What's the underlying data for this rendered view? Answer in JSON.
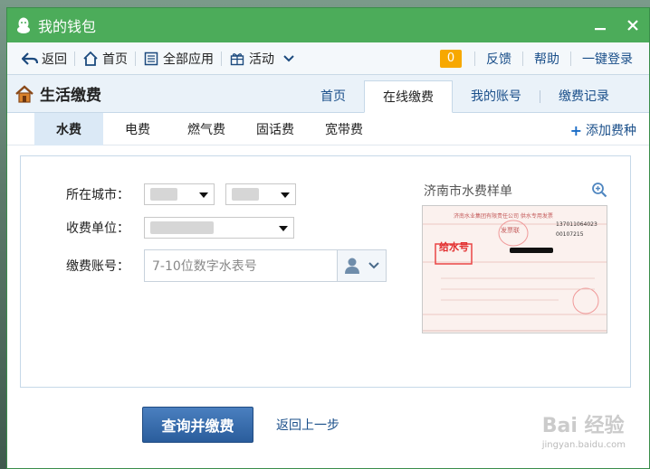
{
  "window": {
    "title": "我的钱包"
  },
  "toolbar": {
    "back": "返回",
    "home": "首页",
    "all_apps": "全部应用",
    "activity": "活动",
    "badge_count": "0",
    "feedback": "反馈",
    "help": "帮助",
    "login": "一键登录"
  },
  "section": {
    "title": "生活缴费",
    "tabs": [
      "首页",
      "在线缴费",
      "我的账号",
      "缴费记录"
    ],
    "active_tab": "在线缴费"
  },
  "subtabs": {
    "items": [
      "水费",
      "电费",
      "燃气费",
      "固话费",
      "宽带费"
    ],
    "active": "水费",
    "add_label": "添加费种"
  },
  "form": {
    "city_label": "所在城市：",
    "unit_label": "收费单位：",
    "account_label": "缴费账号：",
    "account_placeholder": "7-10位数字水表号"
  },
  "sample": {
    "title": "济南市水费样单",
    "bill_header": "济南水业集团有限责任公司 供水专用发票",
    "bill_no_label": "给水号",
    "bill_sub": "发票联",
    "bill_code": "137011064023",
    "bill_number": "00107215"
  },
  "actions": {
    "submit": "查询并缴费",
    "back": "返回上一步"
  },
  "watermark": {
    "main": "Bai 经验",
    "sub": "jingyan.baidu.com"
  },
  "colors": {
    "titlebar": "#4cac5a",
    "primary": "#2a5d9c",
    "link": "#1a4f8a",
    "badge": "#f7a800"
  }
}
